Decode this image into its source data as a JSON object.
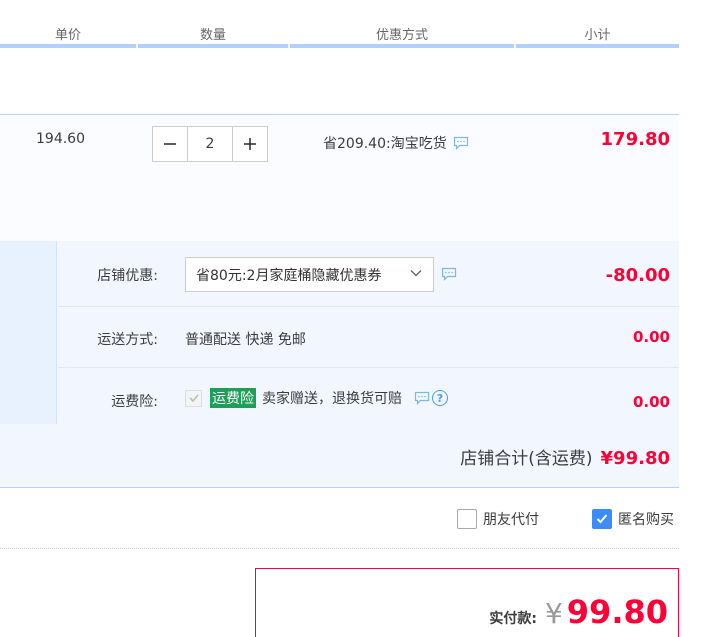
{
  "header": {
    "columns": [
      "单价",
      "数量",
      "优惠方式",
      "小计"
    ]
  },
  "item": {
    "unit_price": "194.60",
    "quantity": "2",
    "minus": "−",
    "plus": "+",
    "promotion": "省209.40:淘宝吃货",
    "subtotal": "179.80"
  },
  "shop": {
    "coupon_label": "店铺优惠:",
    "coupon_value": "省80元:2月家庭桶隐藏优惠券",
    "coupon_amount": "-80.00",
    "shipping_label": "运送方式:",
    "shipping_value": "普通配送 快递 免邮",
    "shipping_amount": "0.00",
    "insurance_label": "运费险:",
    "insurance_tag": "运费险",
    "insurance_text": "卖家赠送，退换货可赔",
    "insurance_amount": "0.00",
    "total_label": "店铺合计(含运费)",
    "total_value": "¥99.80"
  },
  "options": {
    "friend_pay": "朋友代付",
    "anonymous": "匿名购买",
    "anonymous_checked": true
  },
  "payment": {
    "label": "实付款:",
    "currency": "¥",
    "amount": "99.80"
  },
  "colors": {
    "accent_red": "#ff0036",
    "header_line": "#b2d1ff",
    "checkbox_blue": "#3c8cf8",
    "insurance_green": "#1e9e57"
  }
}
